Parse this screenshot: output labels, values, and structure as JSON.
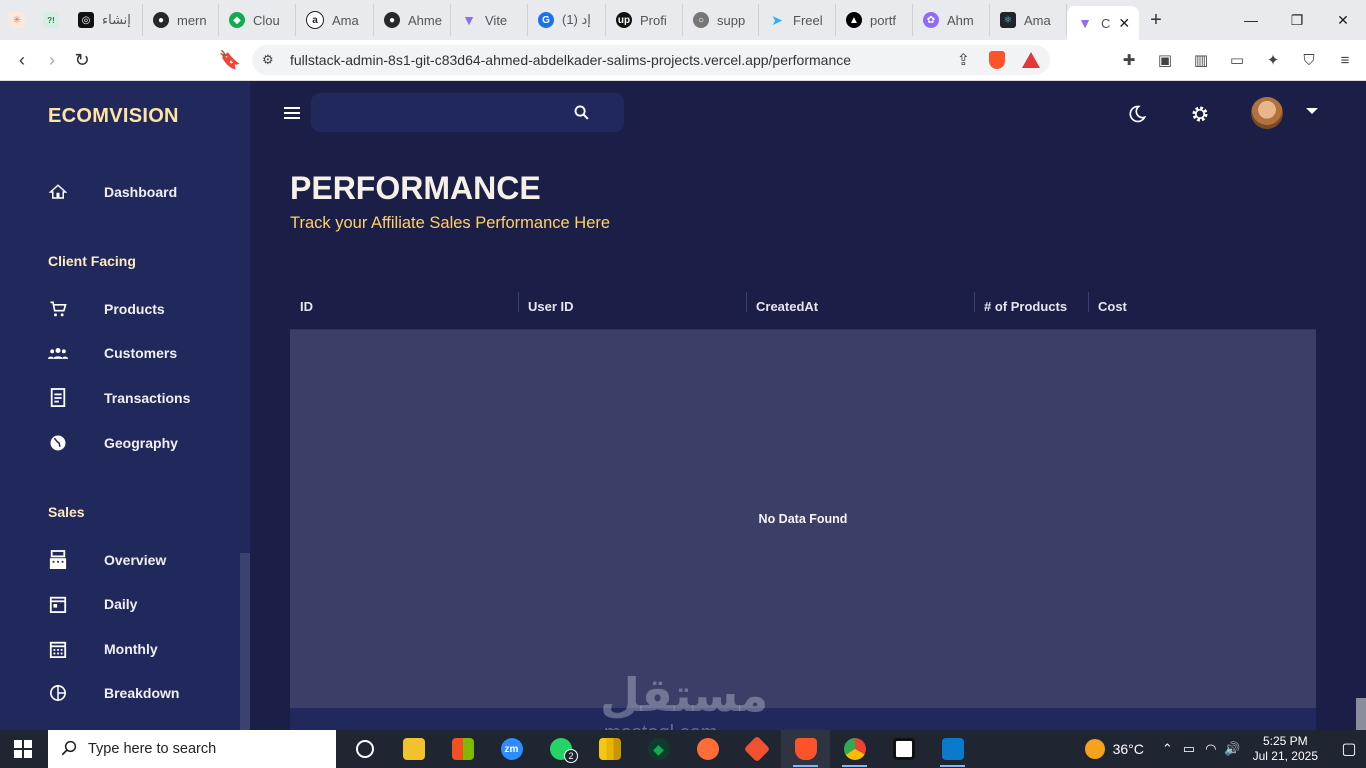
{
  "browser": {
    "tabs": [
      {
        "label": "إنشاء",
        "fav_color": "#111111"
      },
      {
        "label": "mern",
        "fav_color": "#24292e"
      },
      {
        "label": "Clou",
        "fav_color": "#13aa52"
      },
      {
        "label": "Ama",
        "fav_color": "#222222"
      },
      {
        "label": "Ahme",
        "fav_color": "#24292e"
      },
      {
        "label": "Vite",
        "fav_color": "#8e6cf7"
      },
      {
        "label": "(1) إد",
        "fav_color": "#1a73e8"
      },
      {
        "label": "Profi",
        "fav_color": "#111111"
      },
      {
        "label": "supp",
        "fav_color": "#777777"
      },
      {
        "label": "Freel",
        "fav_color": "#29b2fe"
      },
      {
        "label": "portf",
        "fav_color": "#000000"
      },
      {
        "label": "Ahm",
        "fav_color": "#8e6cf7"
      },
      {
        "label": "Ama",
        "fav_color": "#20232a"
      },
      {
        "label": "C",
        "fav_color": "#8e6cf7"
      }
    ],
    "url": "fullstack-admin-8s1-git-c83d64-ahmed-abdelkader-salims-projects.vercel.app/performance"
  },
  "app": {
    "brand": "ECOMVISION",
    "sidebar": {
      "dashboard": "Dashboard",
      "section_client": "Client Facing",
      "products": "Products",
      "customers": "Customers",
      "transactions": "Transactions",
      "geography": "Geography",
      "section_sales": "Sales",
      "overview": "Overview",
      "daily": "Daily",
      "monthly": "Monthly",
      "breakdown": "Breakdown"
    },
    "search": {
      "placeholder": ""
    },
    "page": {
      "title": "PERFORMANCE",
      "subtitle": "Track your Affiliate Sales Performance Here"
    },
    "grid": {
      "columns": [
        "ID",
        "User ID",
        "CreatedAt",
        "# of Products",
        "Cost"
      ],
      "empty": "No Data Found"
    }
  },
  "taskbar": {
    "search_placeholder": "Type here to search",
    "whatsapp_badge": "2",
    "weather": "36°C",
    "time": "5:25 PM",
    "date": "Jul 21, 2025"
  },
  "watermark": {
    "text": "مستقل",
    "sub": "mostaql.com"
  },
  "colors": {
    "accent": "#ffd166",
    "sidebar": "#21295c",
    "background": "#1b1e46"
  }
}
